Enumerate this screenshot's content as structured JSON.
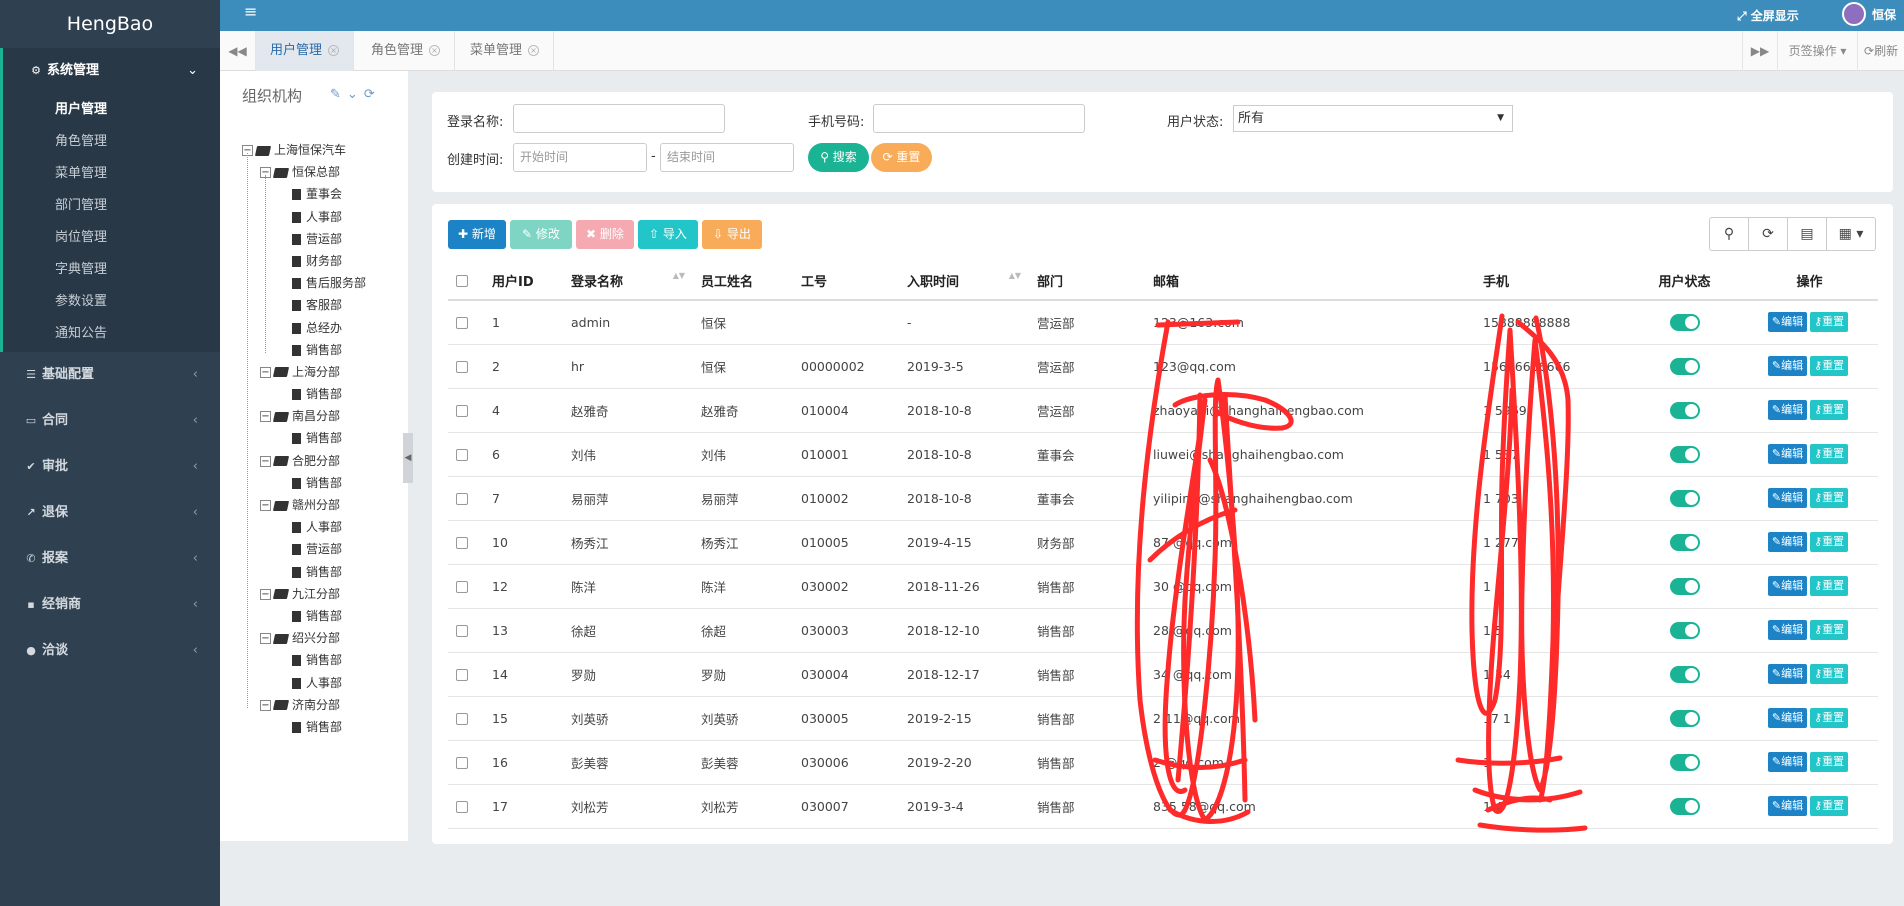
{
  "app": {
    "logo": "HengBao"
  },
  "sidebar": {
    "system_menu": {
      "label": "系统管理",
      "icon": "gear-icon"
    },
    "sub_items": [
      "用户管理",
      "角色管理",
      "菜单管理",
      "部门管理",
      "岗位管理",
      "字典管理",
      "参数设置",
      "通知公告"
    ],
    "active_sub": "用户管理",
    "menus": [
      {
        "label": "基础配置",
        "icon": "database-icon"
      },
      {
        "label": "合同",
        "icon": "folder-icon"
      },
      {
        "label": "审批",
        "icon": "check-icon"
      },
      {
        "label": "退保",
        "icon": "share-icon"
      },
      {
        "label": "报案",
        "icon": "phone-icon"
      },
      {
        "label": "经销商",
        "icon": "lock-icon"
      },
      {
        "label": "洽谈",
        "icon": "chat-icon"
      }
    ]
  },
  "topbar": {
    "fullscreen": "全屏显示",
    "user": "恒保"
  },
  "tabs": {
    "items": [
      "用户管理",
      "角色管理",
      "菜单管理"
    ],
    "active": "用户管理",
    "page_ops": "页签操作",
    "refresh": "刷新"
  },
  "org": {
    "title": "组织机构",
    "tree": [
      {
        "label": "上海恒保汽车",
        "level": 0,
        "type": "folder"
      },
      {
        "label": "恒保总部",
        "level": 1,
        "type": "folder"
      },
      {
        "label": "董事会",
        "level": 2,
        "type": "file"
      },
      {
        "label": "人事部",
        "level": 2,
        "type": "file"
      },
      {
        "label": "营运部",
        "level": 2,
        "type": "file"
      },
      {
        "label": "财务部",
        "level": 2,
        "type": "file"
      },
      {
        "label": "售后服务部",
        "level": 2,
        "type": "file"
      },
      {
        "label": "客服部",
        "level": 2,
        "type": "file"
      },
      {
        "label": "总经办",
        "level": 2,
        "type": "file"
      },
      {
        "label": "销售部",
        "level": 2,
        "type": "file"
      },
      {
        "label": "上海分部",
        "level": 1,
        "type": "folder"
      },
      {
        "label": "销售部",
        "level": 2,
        "type": "file"
      },
      {
        "label": "南昌分部",
        "level": 1,
        "type": "folder"
      },
      {
        "label": "销售部",
        "level": 2,
        "type": "file"
      },
      {
        "label": "合肥分部",
        "level": 1,
        "type": "folder"
      },
      {
        "label": "销售部",
        "level": 2,
        "type": "file"
      },
      {
        "label": "赣州分部",
        "level": 1,
        "type": "folder"
      },
      {
        "label": "人事部",
        "level": 2,
        "type": "file"
      },
      {
        "label": "营运部",
        "level": 2,
        "type": "file"
      },
      {
        "label": "销售部",
        "level": 2,
        "type": "file"
      },
      {
        "label": "九江分部",
        "level": 1,
        "type": "folder"
      },
      {
        "label": "销售部",
        "level": 2,
        "type": "file"
      },
      {
        "label": "绍兴分部",
        "level": 1,
        "type": "folder"
      },
      {
        "label": "销售部",
        "level": 2,
        "type": "file"
      },
      {
        "label": "人事部",
        "level": 2,
        "type": "file"
      },
      {
        "label": "济南分部",
        "level": 1,
        "type": "folder"
      },
      {
        "label": "销售部",
        "level": 2,
        "type": "file"
      }
    ]
  },
  "search": {
    "login_name_label": "登录名称:",
    "phone_label": "手机号码:",
    "status_label": "用户状态:",
    "status_value": "所有",
    "created_label": "创建时间:",
    "start_placeholder": "开始时间",
    "end_placeholder": "结束时间",
    "dash": "-",
    "search_btn": "搜索",
    "reset_btn": "重置"
  },
  "toolbar": {
    "add": "新增",
    "edit": "修改",
    "delete": "删除",
    "import": "导入",
    "export": "导出"
  },
  "table": {
    "columns": [
      "用户ID",
      "登录名称",
      "员工姓名",
      "工号",
      "入职时间",
      "部门",
      "邮箱",
      "手机",
      "用户状态",
      "操作"
    ],
    "rows": [
      {
        "id": "1",
        "login": "admin",
        "name": "恒保",
        "no": "",
        "date": "-",
        "dept": "营运部",
        "email": "123@163.com",
        "phone": "15888888888"
      },
      {
        "id": "2",
        "login": "hr",
        "name": "恒保",
        "no": "00000002",
        "date": "2019-3-5",
        "dept": "营运部",
        "email": "123@qq.com",
        "phone": "15666666666"
      },
      {
        "id": "4",
        "login": "赵雅奇",
        "name": "赵雅奇",
        "no": "010004",
        "date": "2018-10-8",
        "dept": "营运部",
        "email": "zhaoyaqi@shanghaihengbao.com",
        "phone": "1            5969"
      },
      {
        "id": "6",
        "login": "刘伟",
        "name": "刘伟",
        "no": "010001",
        "date": "2018-10-8",
        "dept": "董事会",
        "email": "liuwei@shanghaihengbao.com",
        "phone": "1            537"
      },
      {
        "id": "7",
        "login": "易丽萍",
        "name": "易丽萍",
        "no": "010002",
        "date": "2018-10-8",
        "dept": "董事会",
        "email": "yiliping@shanghaihengbao.com",
        "phone": "1            703"
      },
      {
        "id": "10",
        "login": "杨秀江",
        "name": "杨秀江",
        "no": "010005",
        "date": "2019-4-15",
        "dept": "财务部",
        "email": "87      @qq.com",
        "phone": "1            277"
      },
      {
        "id": "12",
        "login": "陈洋",
        "name": "陈洋",
        "no": "030002",
        "date": "2018-11-26",
        "dept": "销售部",
        "email": "30      @qq.com",
        "phone": "1            0"
      },
      {
        "id": "13",
        "login": "徐超",
        "name": "徐超",
        "no": "030003",
        "date": "2018-12-10",
        "dept": "销售部",
        "email": "28      @qq.com",
        "phone": "1            5"
      },
      {
        "id": "14",
        "login": "罗勋",
        "name": "罗勋",
        "no": "030004",
        "date": "2018-12-17",
        "dept": "销售部",
        "email": "34      @qq.com",
        "phone": "1            34"
      },
      {
        "id": "15",
        "login": "刘英骄",
        "name": "刘英骄",
        "no": "030005",
        "date": "2019-2-15",
        "dept": "销售部",
        "email": "2      11@qq.com",
        "phone": "17           1"
      },
      {
        "id": "16",
        "login": "彭美蓉",
        "name": "彭美蓉",
        "no": "030006",
        "date": "2019-2-20",
        "dept": "销售部",
        "email": "2      @qq.com",
        "phone": "1            "
      },
      {
        "id": "17",
        "login": "刘松芳",
        "name": "刘松芳",
        "no": "030007",
        "date": "2019-3-4",
        "dept": "销售部",
        "email": "835      58@qq.com",
        "phone": "1            4"
      }
    ],
    "edit_label": "编辑",
    "reset_label": "重置"
  },
  "colors": {
    "sidebar": "#2f4050",
    "topbar": "#3c8dbc",
    "primary": "#1ab394",
    "scribble": "#ff2a2a"
  }
}
